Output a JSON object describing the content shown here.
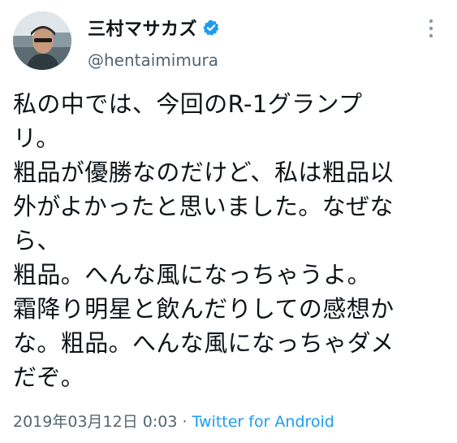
{
  "tweet": {
    "display_name": "三村マサカズ",
    "handle": "@hentaimimura",
    "verified_icon": "verified-badge-icon",
    "more_icon": "more-options-icon",
    "text_lines": [
      "私の中では、今回のR-1グランプ",
      "リ。",
      "粗品が優勝なのだけど、私は粗品以",
      "外がよかったと思いました。なぜな",
      "ら、",
      "粗品。へんな風になっちゃうよ。",
      "霜降り明星と飲んだりしての感想か",
      "な。粗品。へんな風になっちゃダメ",
      "だぞ。"
    ],
    "timestamp": "2019年03月12日 0:03",
    "separator": " · ",
    "source": "Twitter for Android"
  },
  "colors": {
    "text": "#0f1419",
    "secondary": "#536471",
    "accent": "#1d9bf0"
  }
}
